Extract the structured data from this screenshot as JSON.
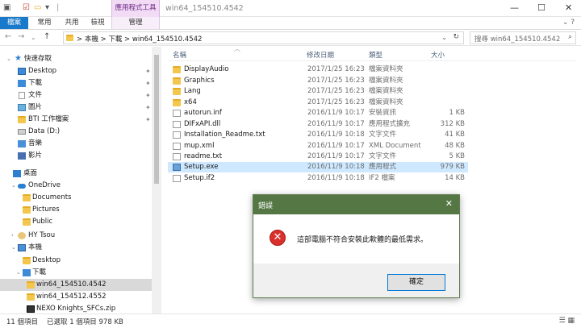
{
  "window": {
    "title": "win64_154510.4542",
    "contextual_tab": "應用程式工具",
    "controls": {
      "minimize": "—",
      "maximize": "☐",
      "close": "✕"
    }
  },
  "ribbon": {
    "tabs": [
      "檔案",
      "常用",
      "共用",
      "檢視",
      "管理"
    ],
    "help": "⌄ ?"
  },
  "address": {
    "crumbs": "> 本機 > 下載 > win64_154510.4542",
    "search_placeholder": "搜尋 win64_154510.4542",
    "dropdown": "⌄",
    "refresh": "↻"
  },
  "nav": {
    "quick_access": "快速存取",
    "items": [
      {
        "label": "Desktop",
        "pinned": true,
        "icon": "desktop-icon"
      },
      {
        "label": "下載",
        "pinned": true,
        "icon": "download-icon"
      },
      {
        "label": "文件",
        "pinned": true,
        "icon": "documents-icon"
      },
      {
        "label": "圖片",
        "pinned": true,
        "icon": "pictures-icon"
      },
      {
        "label": "BTI 工作檔案",
        "pinned": true,
        "icon": "folder-icon"
      },
      {
        "label": "Data (D:)",
        "pinned": false,
        "icon": "drive-icon"
      },
      {
        "label": "音樂",
        "pinned": false,
        "icon": "music-icon"
      },
      {
        "label": "影片",
        "pinned": false,
        "icon": "video-icon"
      },
      {
        "label": "桌面",
        "pinned": false,
        "icon": "desktop-icon"
      },
      {
        "label": "OneDrive",
        "pinned": false,
        "icon": "onedrive-icon"
      },
      {
        "label": "Documents",
        "pinned": false,
        "icon": "folder-icon"
      },
      {
        "label": "Pictures",
        "pinned": false,
        "icon": "folder-icon"
      },
      {
        "label": "Public",
        "pinned": false,
        "icon": "folder-icon"
      },
      {
        "label": "HY Tsou",
        "pinned": false,
        "icon": "user-icon"
      },
      {
        "label": "本機",
        "pinned": false,
        "icon": "computer-icon"
      },
      {
        "label": "Desktop",
        "pinned": false,
        "icon": "folder-icon"
      },
      {
        "label": "下載",
        "pinned": false,
        "icon": "download-icon"
      },
      {
        "label": "win64_154510.4542",
        "pinned": false,
        "icon": "folder-icon"
      },
      {
        "label": "win64_154512.4552",
        "pinned": false,
        "icon": "folder-icon"
      },
      {
        "label": "NEXO Knights_SFCs.zip",
        "pinned": false,
        "icon": "zip-icon"
      }
    ]
  },
  "columns": {
    "name": "名稱",
    "date": "修改日期",
    "type": "類型",
    "size": "大小"
  },
  "files": [
    {
      "name": "DisplayAudio",
      "date": "2017/1/25 16:23",
      "type": "檔案資料夾",
      "size": "",
      "icon": "folder-icon"
    },
    {
      "name": "Graphics",
      "date": "2017/1/25 16:23",
      "type": "檔案資料夾",
      "size": "",
      "icon": "folder-icon"
    },
    {
      "name": "Lang",
      "date": "2017/1/25 16:23",
      "type": "檔案資料夾",
      "size": "",
      "icon": "folder-icon"
    },
    {
      "name": "x64",
      "date": "2017/1/25 16:23",
      "type": "檔案資料夾",
      "size": "",
      "icon": "folder-icon"
    },
    {
      "name": "autorun.inf",
      "date": "2016/11/9 10:17",
      "type": "安裝資訊",
      "size": "1 KB",
      "icon": "file-icon"
    },
    {
      "name": "DIFxAPI.dll",
      "date": "2016/11/9 10:17",
      "type": "應用程式擴充",
      "size": "312 KB",
      "icon": "file-icon"
    },
    {
      "name": "Installation_Readme.txt",
      "date": "2016/11/9 10:18",
      "type": "文字文件",
      "size": "41 KB",
      "icon": "file-icon"
    },
    {
      "name": "mup.xml",
      "date": "2016/11/9 10:17",
      "type": "XML Document",
      "size": "48 KB",
      "icon": "file-icon"
    },
    {
      "name": "readme.txt",
      "date": "2016/11/9 10:17",
      "type": "文字文件",
      "size": "5 KB",
      "icon": "file-icon"
    },
    {
      "name": "Setup.exe",
      "date": "2016/11/9 10:18",
      "type": "應用程式",
      "size": "979 KB",
      "icon": "exe-icon"
    },
    {
      "name": "Setup.if2",
      "date": "2016/11/9 10:18",
      "type": "IF2 檔案",
      "size": "14 KB",
      "icon": "file-icon"
    }
  ],
  "status": {
    "count": "11 個項目",
    "selection": "已選取 1 個項目  978 KB"
  },
  "dialog": {
    "title": "錯誤",
    "message": "這部電腦不符合安裝此軟體的最低需求。",
    "ok": "確定",
    "close": "✕",
    "accent": "#547744"
  }
}
